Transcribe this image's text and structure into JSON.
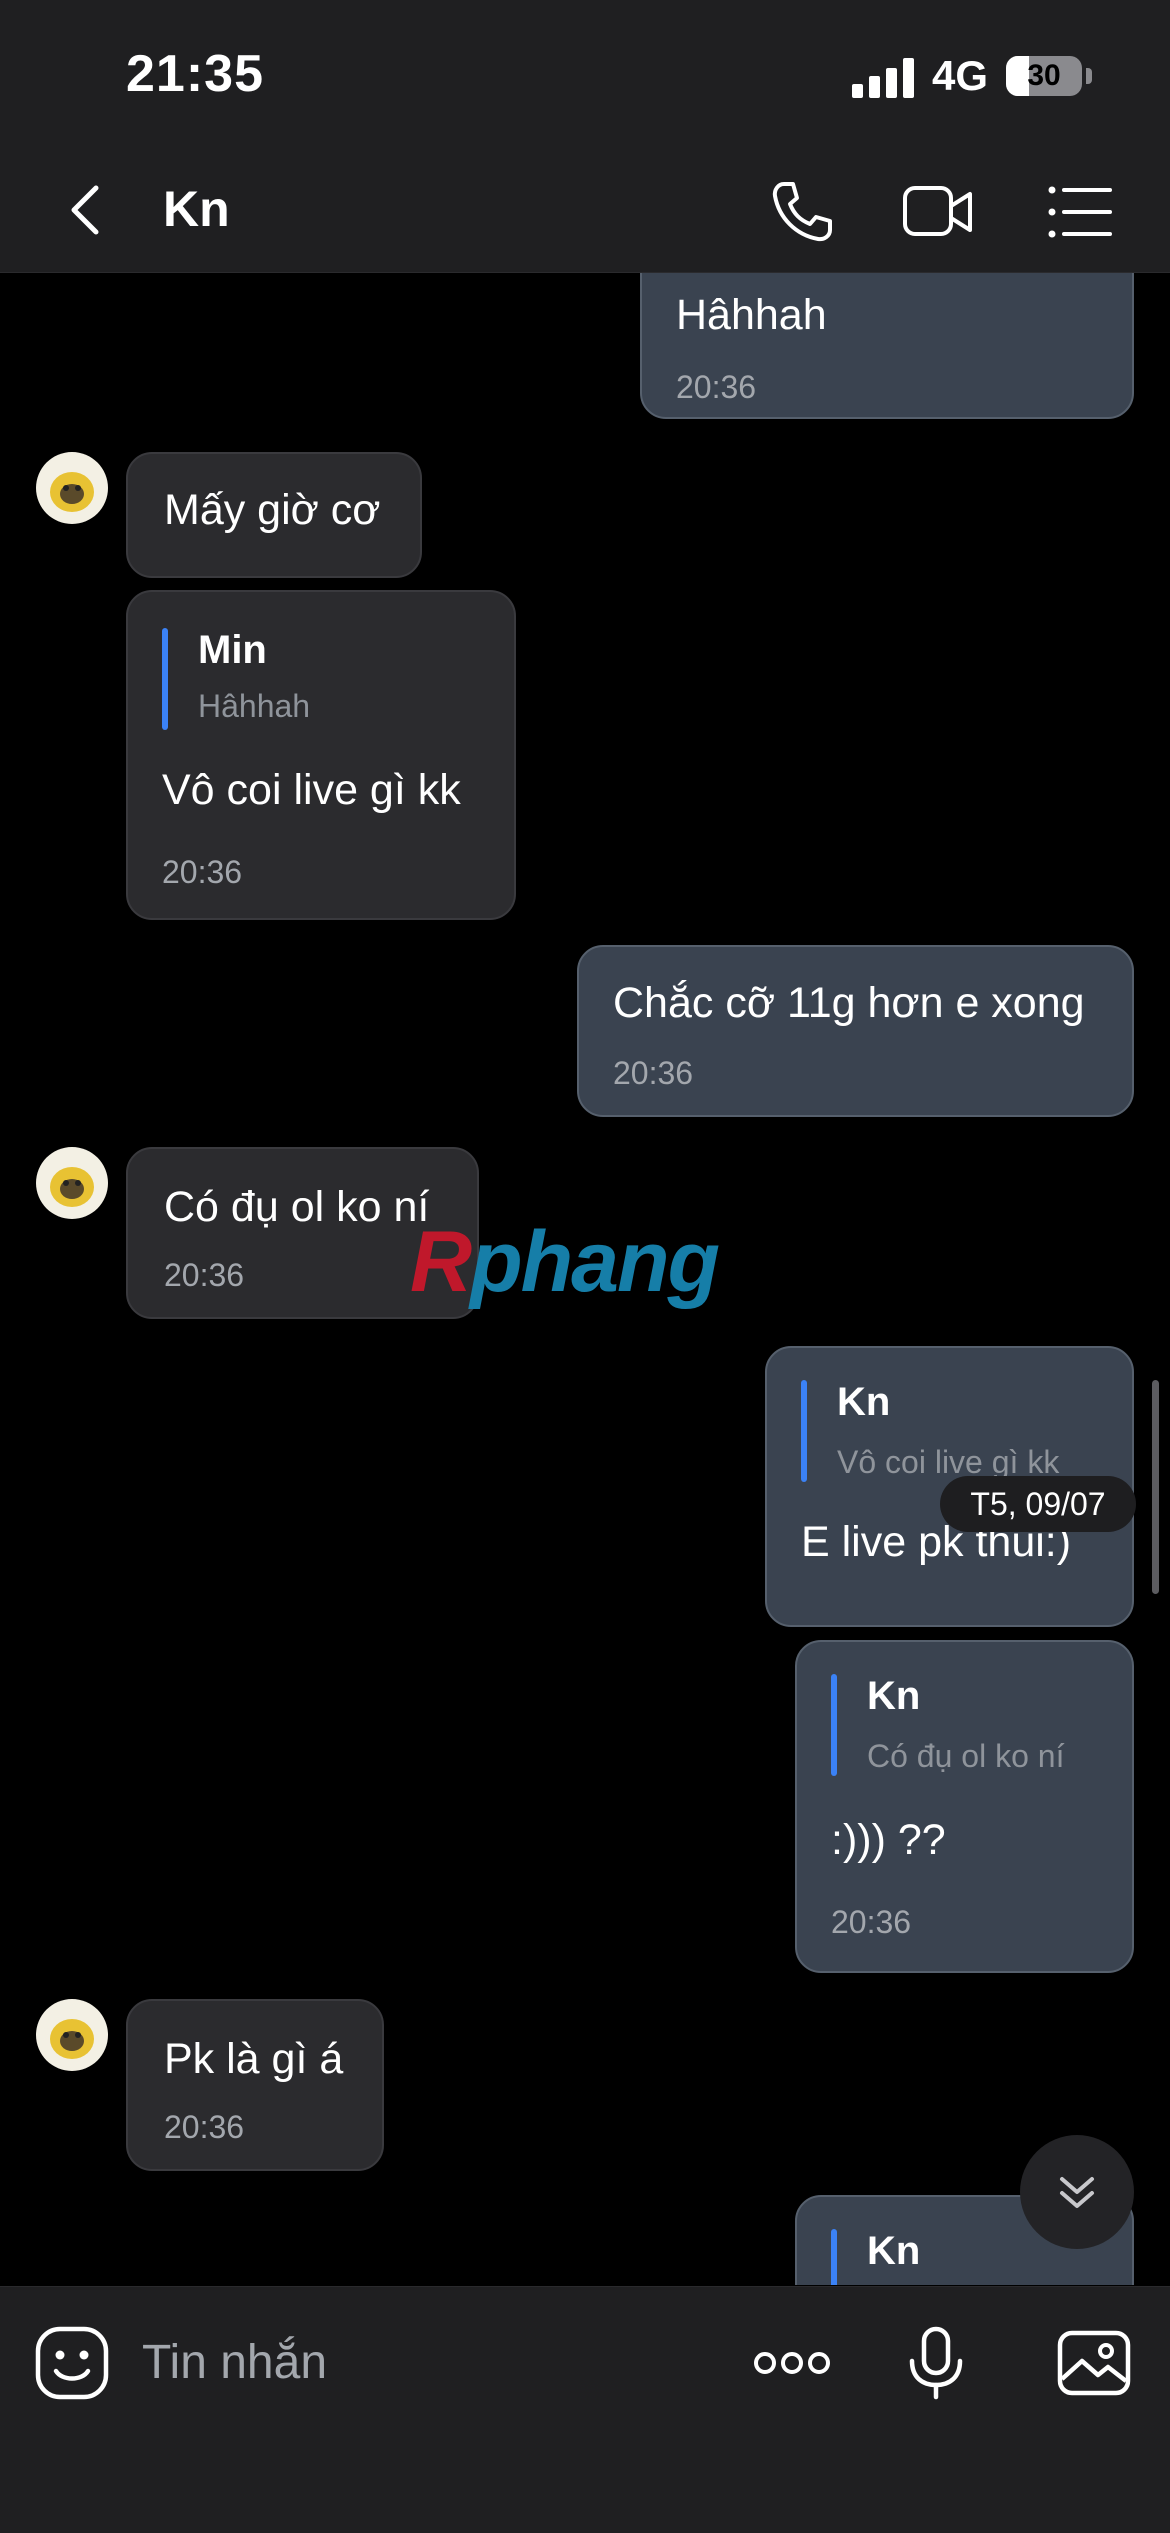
{
  "status_bar": {
    "time": "21:35",
    "network": "4G",
    "battery": "30",
    "battery_level": 0.3
  },
  "header": {
    "title": "Kn"
  },
  "chat": {
    "messages": [
      {
        "text": "Hâhhah",
        "time": "20:36"
      },
      {
        "text": "Mấy giờ cơ"
      },
      {
        "quote_name": "Min",
        "quote_text": "Hâhhah",
        "text": "Vô coi live gì kk",
        "time": "20:36"
      },
      {
        "text": "Chắc cỡ 11g hơn e xong",
        "time": "20:36"
      },
      {
        "text": "Có đụ ol ko ní",
        "time": "20:36"
      },
      {
        "quote_name": "Kn",
        "quote_text": "Vô coi live gì kk",
        "text": "E live pk thui:)"
      },
      {
        "quote_name": "Kn",
        "quote_text": "Có đụ ol ko ní",
        "text": ":))) ??",
        "time": "20:36"
      },
      {
        "text": "Pk là gì á",
        "time": "20:36"
      },
      {
        "quote_name": "Kn"
      }
    ],
    "date_separator": "T5, 09/07"
  },
  "watermark": {
    "first": "R",
    "rest": "phang"
  },
  "input": {
    "placeholder": "Tin nhắn"
  },
  "icons": [
    "back-icon",
    "phone-icon",
    "video-call-icon",
    "menu-list-icon",
    "sticker-icon",
    "more-options-icon",
    "microphone-icon",
    "image-icon",
    "scroll-down-icon"
  ],
  "colors": {
    "accent": "#3b82f6",
    "bubble_in": "#2b2b2e",
    "bubble_out": "#3a4350"
  }
}
